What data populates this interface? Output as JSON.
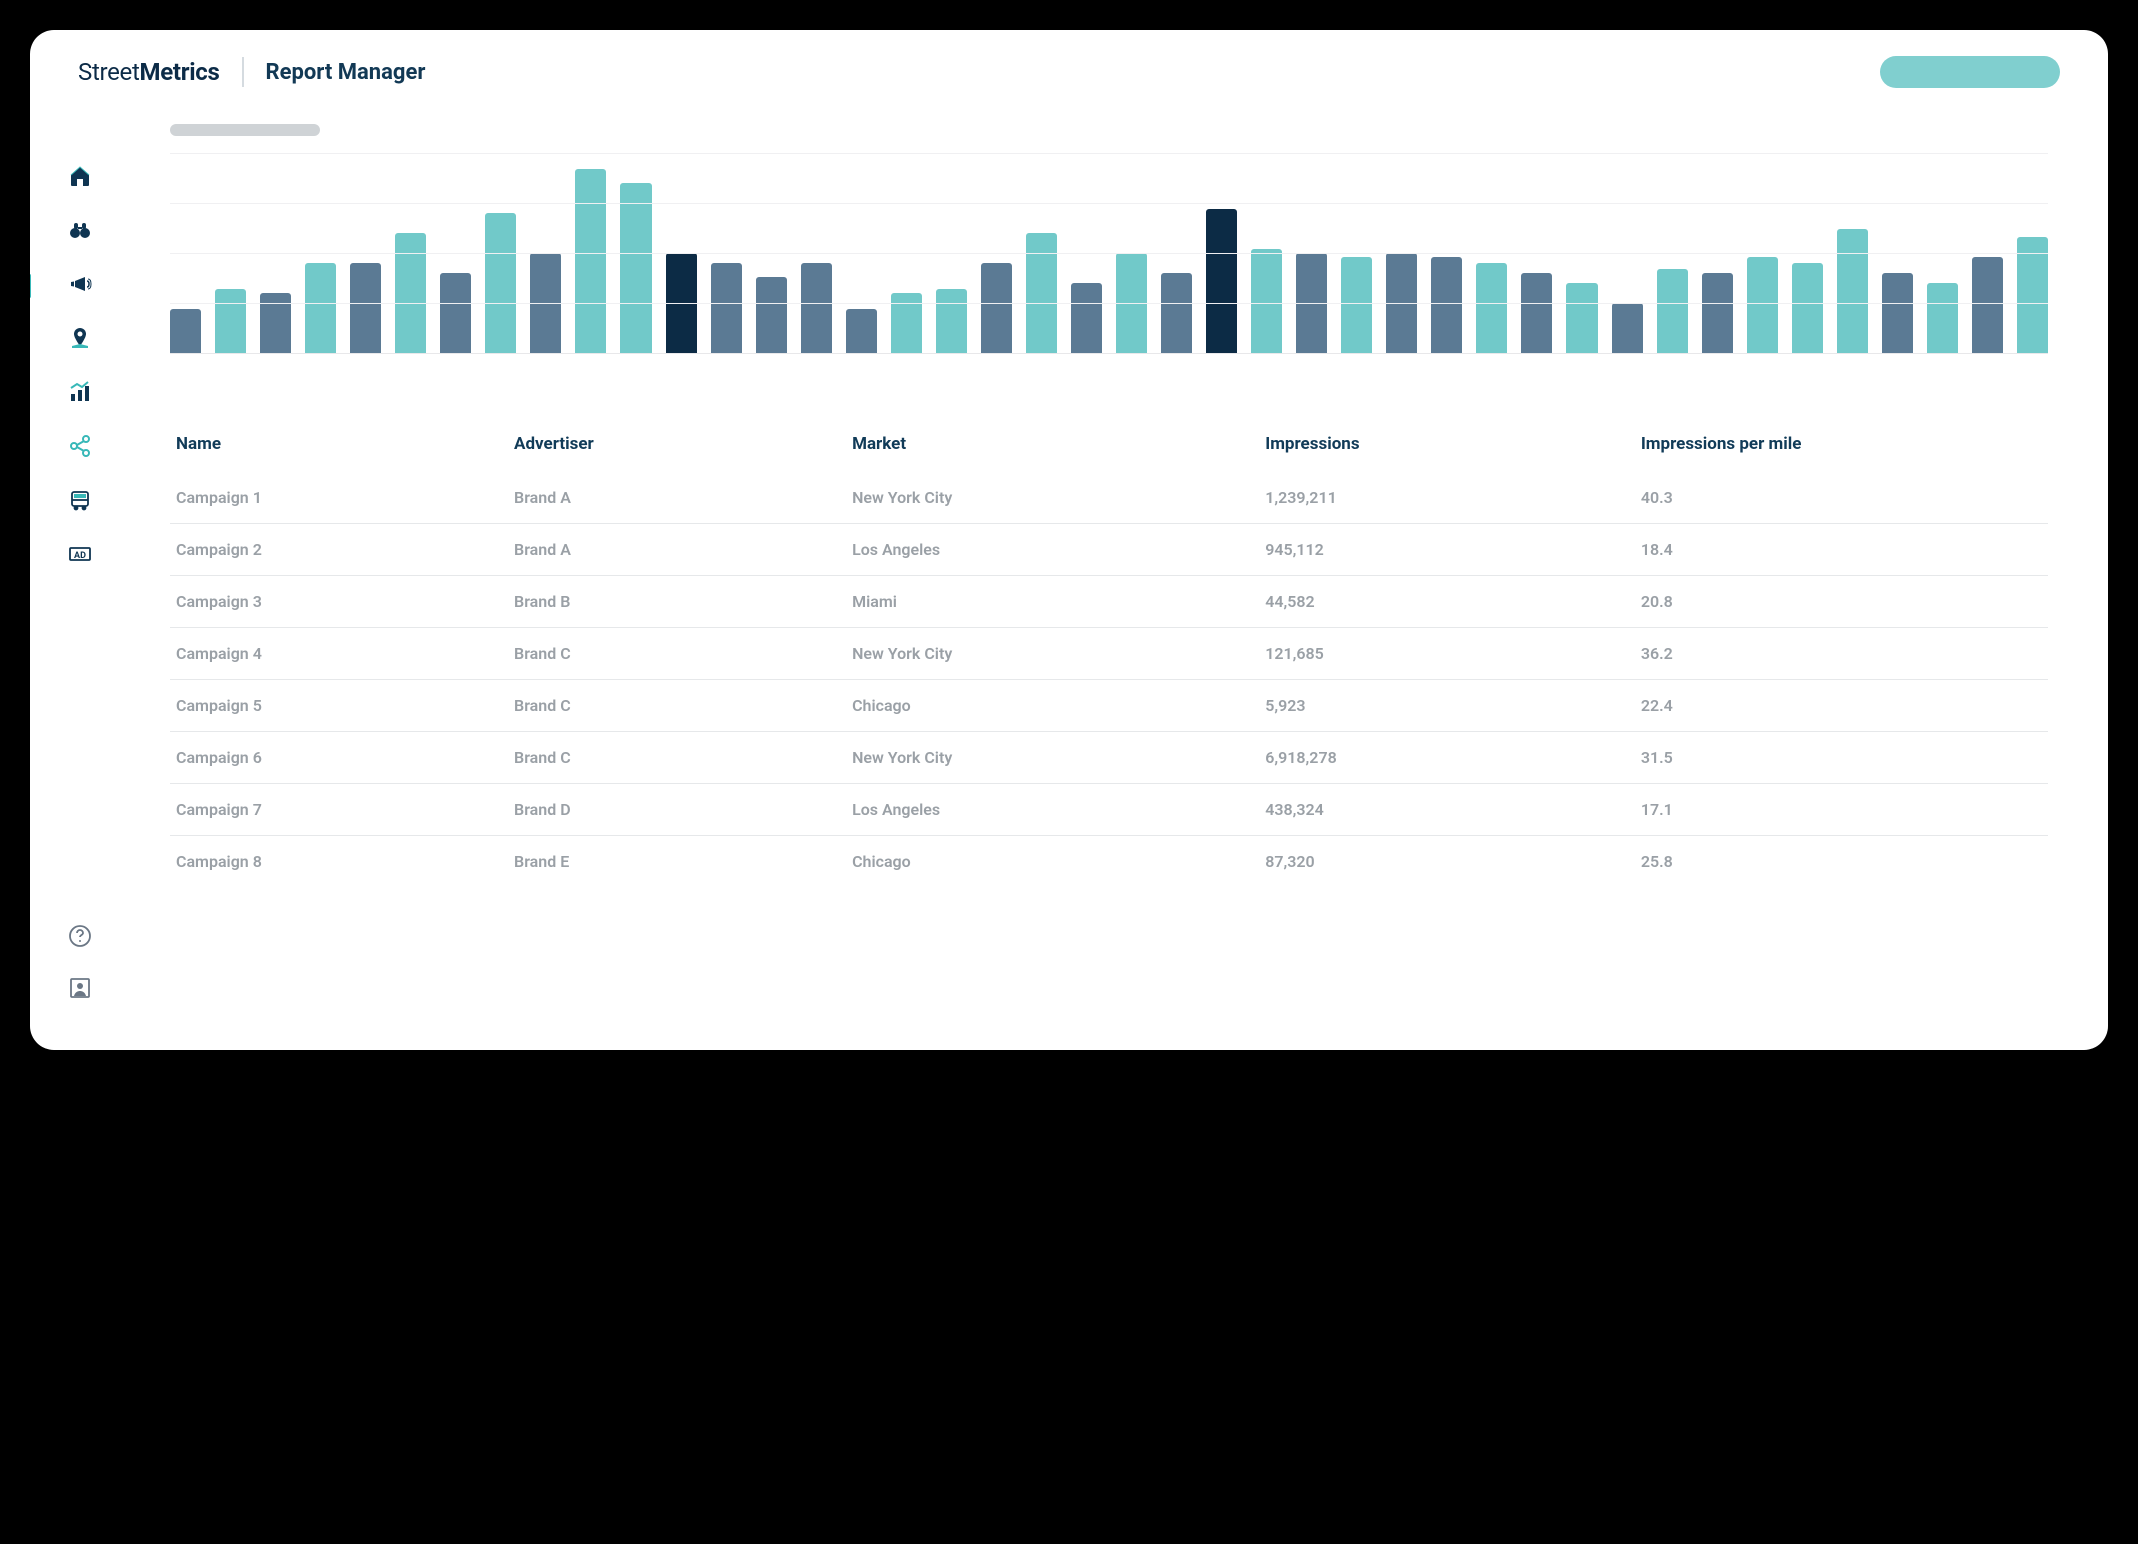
{
  "header": {
    "logo_prefix": "Street",
    "logo_bold": "Metrics",
    "page_title": "Report Manager"
  },
  "sidebar": {
    "items": [
      {
        "name": "home"
      },
      {
        "name": "binoculars"
      },
      {
        "name": "megaphone",
        "active": true
      },
      {
        "name": "map-pin"
      },
      {
        "name": "chart"
      },
      {
        "name": "share"
      },
      {
        "name": "bus"
      },
      {
        "name": "ad"
      }
    ]
  },
  "table": {
    "headers": {
      "name": "Name",
      "advertiser": "Advertiser",
      "market": "Market",
      "impressions": "Impressions",
      "ipm": "Impressions per mile"
    },
    "rows": [
      {
        "name": "Campaign 1",
        "advertiser": "Brand A",
        "market": "New York City",
        "impressions": "1,239,211",
        "ipm": "40.3"
      },
      {
        "name": "Campaign 2",
        "advertiser": "Brand A",
        "market": "Los Angeles",
        "impressions": "945,112",
        "ipm": "18.4"
      },
      {
        "name": "Campaign 3",
        "advertiser": "Brand B",
        "market": "Miami",
        "impressions": "44,582",
        "ipm": "20.8"
      },
      {
        "name": "Campaign 4",
        "advertiser": "Brand C",
        "market": "New York City",
        "impressions": "121,685",
        "ipm": "36.2"
      },
      {
        "name": "Campaign 5",
        "advertiser": "Brand C",
        "market": "Chicago",
        "impressions": "5,923",
        "ipm": "22.4"
      },
      {
        "name": "Campaign 6",
        "advertiser": "Brand C",
        "market": "New York City",
        "impressions": "6,918,278",
        "ipm": "31.5"
      },
      {
        "name": "Campaign 7",
        "advertiser": "Brand D",
        "market": "Los Angeles",
        "impressions": "438,324",
        "ipm": "17.1"
      },
      {
        "name": "Campaign 8",
        "advertiser": "Brand E",
        "market": "Chicago",
        "impressions": "87,320",
        "ipm": "25.8"
      }
    ]
  },
  "chart_data": {
    "type": "bar",
    "title": "",
    "xlabel": "",
    "ylabel": "",
    "ylim": [
      0,
      100
    ],
    "bars": [
      {
        "value": 22,
        "color": 0
      },
      {
        "value": 32,
        "color": 1
      },
      {
        "value": 30,
        "color": 0
      },
      {
        "value": 45,
        "color": 1
      },
      {
        "value": 45,
        "color": 0
      },
      {
        "value": 60,
        "color": 1
      },
      {
        "value": 40,
        "color": 0
      },
      {
        "value": 70,
        "color": 1
      },
      {
        "value": 50,
        "color": 0
      },
      {
        "value": 92,
        "color": 1
      },
      {
        "value": 85,
        "color": 1
      },
      {
        "value": 50,
        "color": 2
      },
      {
        "value": 45,
        "color": 0
      },
      {
        "value": 38,
        "color": 0
      },
      {
        "value": 45,
        "color": 0
      },
      {
        "value": 22,
        "color": 0
      },
      {
        "value": 30,
        "color": 1
      },
      {
        "value": 32,
        "color": 1
      },
      {
        "value": 45,
        "color": 0
      },
      {
        "value": 60,
        "color": 1
      },
      {
        "value": 35,
        "color": 0
      },
      {
        "value": 50,
        "color": 1
      },
      {
        "value": 40,
        "color": 0
      },
      {
        "value": 72,
        "color": 2
      },
      {
        "value": 52,
        "color": 1
      },
      {
        "value": 50,
        "color": 0
      },
      {
        "value": 48,
        "color": 1
      },
      {
        "value": 50,
        "color": 0
      },
      {
        "value": 48,
        "color": 0
      },
      {
        "value": 45,
        "color": 1
      },
      {
        "value": 40,
        "color": 0
      },
      {
        "value": 35,
        "color": 1
      },
      {
        "value": 25,
        "color": 0
      },
      {
        "value": 42,
        "color": 1
      },
      {
        "value": 40,
        "color": 0
      },
      {
        "value": 48,
        "color": 1
      },
      {
        "value": 45,
        "color": 1
      },
      {
        "value": 62,
        "color": 1
      },
      {
        "value": 40,
        "color": 0
      },
      {
        "value": 35,
        "color": 1
      },
      {
        "value": 48,
        "color": 0
      },
      {
        "value": 58,
        "color": 1
      }
    ]
  }
}
